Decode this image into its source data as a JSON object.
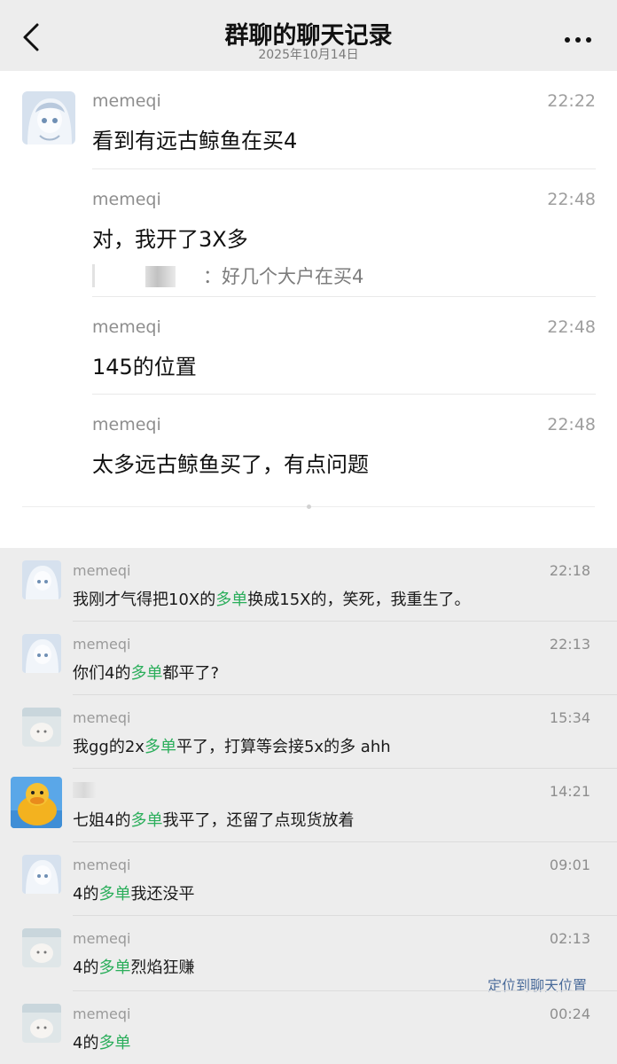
{
  "header": {
    "title": "群聊的聊天记录",
    "date": "2025年10月14日"
  },
  "record": {
    "messages": [
      {
        "name": "memeqi",
        "time": "22:22",
        "text": "看到有远古鲸鱼在买4"
      },
      {
        "name": "memeqi",
        "time": "22:48",
        "text": "对，我开了3X多",
        "quote": "：好几个大户在买4"
      },
      {
        "name": "memeqi",
        "time": "22:48",
        "text": "145的位置"
      },
      {
        "name": "memeqi",
        "time": "22:48",
        "text": "太多远古鲸鱼买了，有点问题"
      }
    ]
  },
  "results": [
    {
      "name": "memeqi",
      "time": "22:18",
      "pre": "我刚才气得把10X的",
      "hl": "多单",
      "post": "换成15X的，笑死，我重生了。",
      "avatar": "anime-girl"
    },
    {
      "name": "memeqi",
      "time": "22:13",
      "pre": "你们4的",
      "hl": "多单",
      "post": "都平了?",
      "avatar": "anime-girl"
    },
    {
      "name": "memeqi",
      "time": "15:34",
      "pre": "我gg的2x",
      "hl": "多单",
      "post": "平了，打算等会接5x的多 ahh",
      "avatar": "sketch"
    },
    {
      "name": "",
      "time": "14:21",
      "pre": "七姐4的",
      "hl": "多单",
      "post": "我平了，还留了点现货放着",
      "avatar": "yellow-duck"
    },
    {
      "name": "memeqi",
      "time": "09:01",
      "pre": "4的",
      "hl": "多单",
      "post": "我还没平",
      "avatar": "anime-girl"
    },
    {
      "name": "memeqi",
      "time": "02:13",
      "pre": "4的",
      "hl": "多单",
      "post": "烈焰狂赚",
      "avatar": "sketch"
    },
    {
      "name": "memeqi",
      "time": "00:24",
      "pre": "4的",
      "hl": "多单",
      "post": "",
      "avatar": "sketch"
    }
  ],
  "locate_label": "定位到聊天位置",
  "colors": {
    "highlight": "#2bae5b",
    "link": "#4a6b9a",
    "header_bg": "#ededed"
  }
}
